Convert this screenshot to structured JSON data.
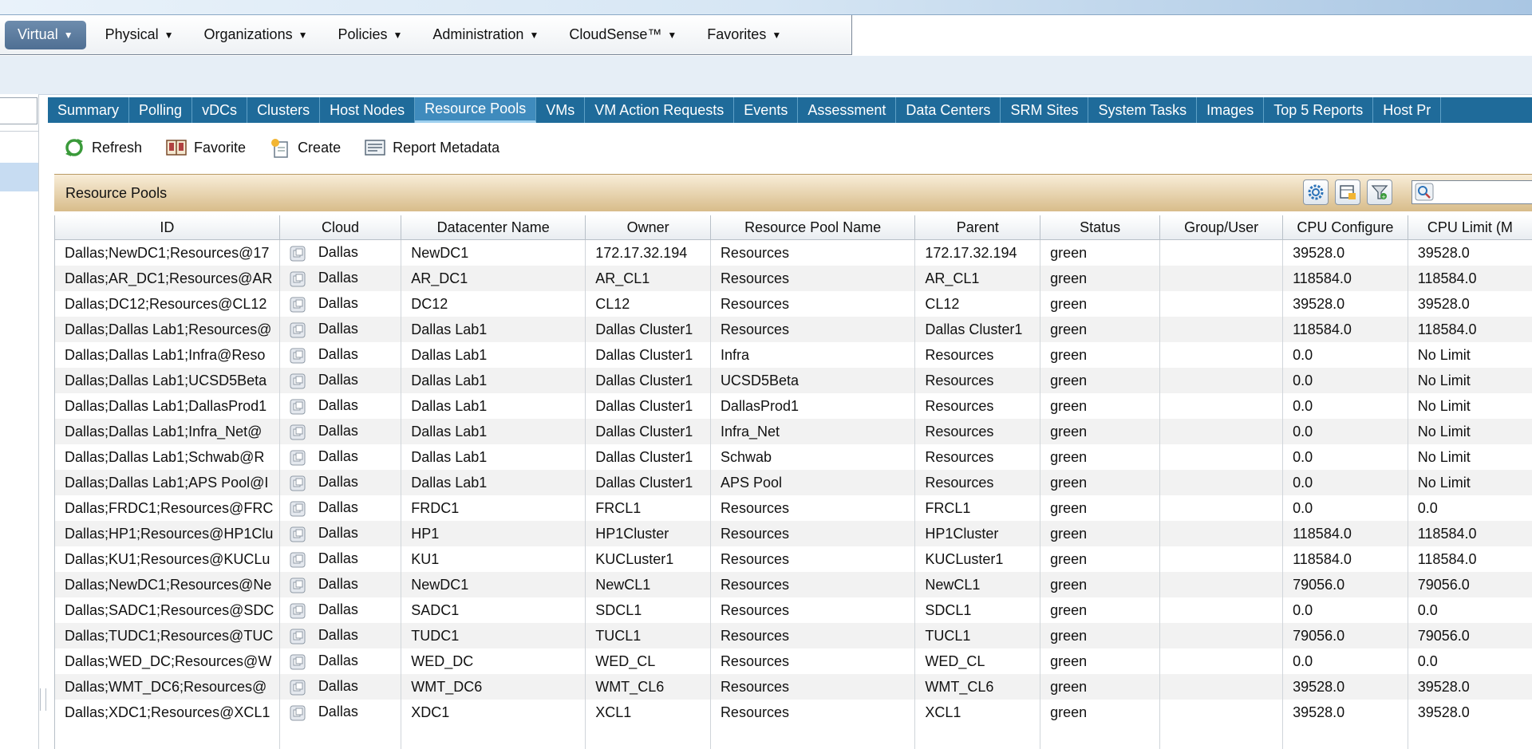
{
  "menu": {
    "items": [
      {
        "label": "Virtual",
        "active": true
      },
      {
        "label": "Physical"
      },
      {
        "label": "Organizations"
      },
      {
        "label": "Policies"
      },
      {
        "label": "Administration"
      },
      {
        "label": "CloudSense™"
      },
      {
        "label": "Favorites"
      }
    ]
  },
  "tabs": [
    {
      "label": "Summary"
    },
    {
      "label": "Polling"
    },
    {
      "label": "vDCs"
    },
    {
      "label": "Clusters"
    },
    {
      "label": "Host Nodes"
    },
    {
      "label": "Resource Pools",
      "active": true
    },
    {
      "label": "VMs"
    },
    {
      "label": "VM Action Requests"
    },
    {
      "label": "Events"
    },
    {
      "label": "Assessment"
    },
    {
      "label": "Data Centers"
    },
    {
      "label": "SRM Sites"
    },
    {
      "label": "System Tasks"
    },
    {
      "label": "Images"
    },
    {
      "label": "Top 5 Reports"
    },
    {
      "label": "Host Pr"
    }
  ],
  "toolbar": {
    "refresh": "Refresh",
    "favorite": "Favorite",
    "create": "Create",
    "report_metadata": "Report Metadata"
  },
  "panel": {
    "title": "Resource Pools"
  },
  "colors": {
    "tabbar": "#1f6b9a",
    "active_menu": "#5a7a9e",
    "status_green": "green"
  },
  "table": {
    "columns": [
      "ID",
      "Cloud",
      "Datacenter Name",
      "Owner",
      "Resource Pool Name",
      "Parent",
      "Status",
      "Group/User",
      "CPU Configure",
      "CPU Limit (M"
    ],
    "rows": [
      [
        "Dallas;NewDC1;Resources@17",
        "Dallas",
        "NewDC1",
        "172.17.32.194",
        "Resources",
        "172.17.32.194",
        "green",
        "",
        "39528.0",
        "39528.0"
      ],
      [
        "Dallas;AR_DC1;Resources@AR",
        "Dallas",
        "AR_DC1",
        "AR_CL1",
        "Resources",
        "AR_CL1",
        "green",
        "",
        "118584.0",
        "118584.0"
      ],
      [
        "Dallas;DC12;Resources@CL12",
        "Dallas",
        "DC12",
        "CL12",
        "Resources",
        "CL12",
        "green",
        "",
        "39528.0",
        "39528.0"
      ],
      [
        "Dallas;Dallas Lab1;Resources@",
        "Dallas",
        "Dallas Lab1",
        "Dallas Cluster1",
        "Resources",
        "Dallas Cluster1",
        "green",
        "",
        "118584.0",
        "118584.0"
      ],
      [
        "Dallas;Dallas Lab1;Infra@Reso",
        "Dallas",
        "Dallas Lab1",
        "Dallas Cluster1",
        "Infra",
        "Resources",
        "green",
        "",
        "0.0",
        "No Limit"
      ],
      [
        "Dallas;Dallas Lab1;UCSD5Beta",
        "Dallas",
        "Dallas Lab1",
        "Dallas Cluster1",
        "UCSD5Beta",
        "Resources",
        "green",
        "",
        "0.0",
        "No Limit"
      ],
      [
        "Dallas;Dallas Lab1;DallasProd1",
        "Dallas",
        "Dallas Lab1",
        "Dallas Cluster1",
        "DallasProd1",
        "Resources",
        "green",
        "",
        "0.0",
        "No Limit"
      ],
      [
        "Dallas;Dallas Lab1;Infra_Net@",
        "Dallas",
        "Dallas Lab1",
        "Dallas Cluster1",
        "Infra_Net",
        "Resources",
        "green",
        "",
        "0.0",
        "No Limit"
      ],
      [
        "Dallas;Dallas Lab1;Schwab@R",
        "Dallas",
        "Dallas Lab1",
        "Dallas Cluster1",
        "Schwab",
        "Resources",
        "green",
        "",
        "0.0",
        "No Limit"
      ],
      [
        "Dallas;Dallas Lab1;APS Pool@I",
        "Dallas",
        "Dallas Lab1",
        "Dallas Cluster1",
        "APS Pool",
        "Resources",
        "green",
        "",
        "0.0",
        "No Limit"
      ],
      [
        "Dallas;FRDC1;Resources@FRC",
        "Dallas",
        "FRDC1",
        "FRCL1",
        "Resources",
        "FRCL1",
        "green",
        "",
        "0.0",
        "0.0"
      ],
      [
        "Dallas;HP1;Resources@HP1Clu",
        "Dallas",
        "HP1",
        "HP1Cluster",
        "Resources",
        "HP1Cluster",
        "green",
        "",
        "118584.0",
        "118584.0"
      ],
      [
        "Dallas;KU1;Resources@KUCLu",
        "Dallas",
        "KU1",
        "KUCLuster1",
        "Resources",
        "KUCLuster1",
        "green",
        "",
        "118584.0",
        "118584.0"
      ],
      [
        "Dallas;NewDC1;Resources@Ne",
        "Dallas",
        "NewDC1",
        "NewCL1",
        "Resources",
        "NewCL1",
        "green",
        "",
        "79056.0",
        "79056.0"
      ],
      [
        "Dallas;SADC1;Resources@SDC",
        "Dallas",
        "SADC1",
        "SDCL1",
        "Resources",
        "SDCL1",
        "green",
        "",
        "0.0",
        "0.0"
      ],
      [
        "Dallas;TUDC1;Resources@TUC",
        "Dallas",
        "TUDC1",
        "TUCL1",
        "Resources",
        "TUCL1",
        "green",
        "",
        "79056.0",
        "79056.0"
      ],
      [
        "Dallas;WED_DC;Resources@W",
        "Dallas",
        "WED_DC",
        "WED_CL",
        "Resources",
        "WED_CL",
        "green",
        "",
        "0.0",
        "0.0"
      ],
      [
        "Dallas;WMT_DC6;Resources@",
        "Dallas",
        "WMT_DC6",
        "WMT_CL6",
        "Resources",
        "WMT_CL6",
        "green",
        "",
        "39528.0",
        "39528.0"
      ],
      [
        "Dallas;XDC1;Resources@XCL1",
        "Dallas",
        "XDC1",
        "XCL1",
        "Resources",
        "XCL1",
        "green",
        "",
        "39528.0",
        "39528.0"
      ]
    ]
  }
}
